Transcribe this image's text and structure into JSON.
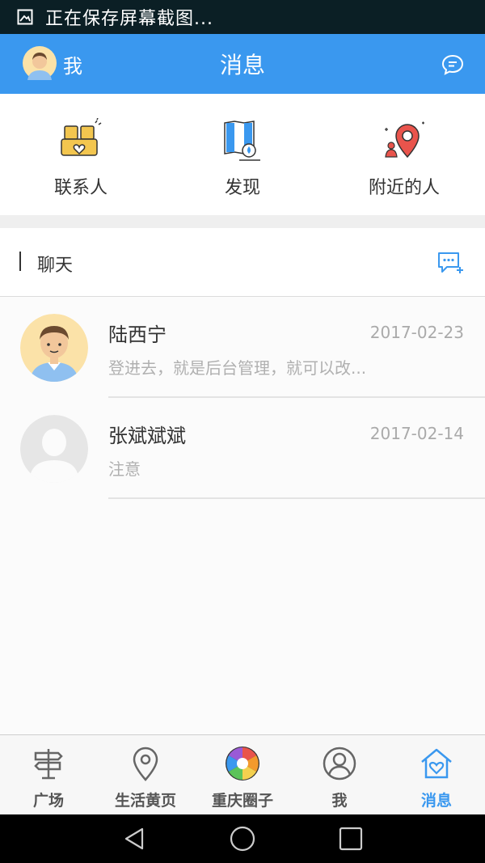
{
  "status_bar": {
    "text": "正在保存屏幕截图..."
  },
  "header": {
    "me_label": "我",
    "title": "消息"
  },
  "quick_entries": [
    {
      "label": "联系人",
      "icon": "contacts-icon"
    },
    {
      "label": "发现",
      "icon": "discover-map-icon"
    },
    {
      "label": "附近的人",
      "icon": "nearby-people-icon"
    }
  ],
  "chat_section": {
    "label": "聊天"
  },
  "conversations": [
    {
      "name": "陆西宁",
      "date": "2017-02-23",
      "preview": "登进去，就是后台管理，就可以改..."
    },
    {
      "name": "张斌斌斌",
      "date": "2017-02-14",
      "preview": "注意"
    }
  ],
  "tabs": [
    {
      "label": "广场",
      "icon": "signpost-icon",
      "active": false
    },
    {
      "label": "生活黄页",
      "icon": "location-pin-icon",
      "active": false
    },
    {
      "label": "重庆圈子",
      "icon": "aperture-icon",
      "active": false
    },
    {
      "label": "我",
      "icon": "person-icon",
      "active": false
    },
    {
      "label": "消息",
      "icon": "home-heart-icon",
      "active": true
    }
  ],
  "colors": {
    "header_blue": "#3a98ef",
    "status_bar": "#0b1f25",
    "accent_red": "#e9544c",
    "accent_yellow": "#f3c64f"
  }
}
